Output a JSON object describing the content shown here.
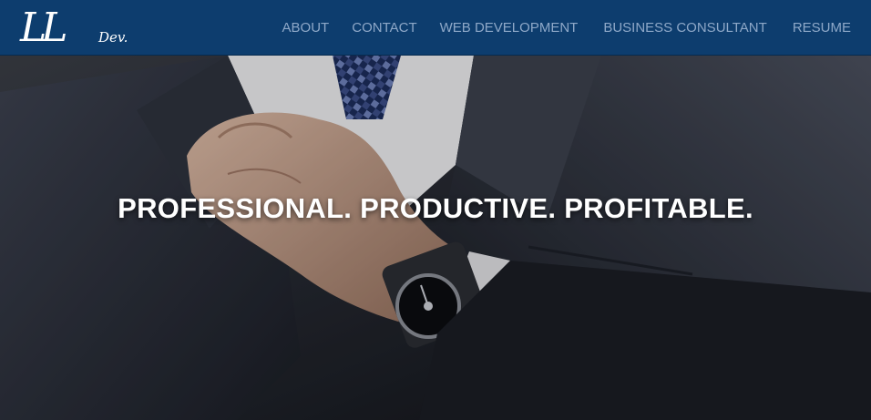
{
  "brand": {
    "initials": "LL",
    "suffix": "Dev."
  },
  "nav": {
    "items": [
      {
        "label": "ABOUT"
      },
      {
        "label": "CONTACT"
      },
      {
        "label": "WEB DEVELOPMENT"
      },
      {
        "label": "BUSINESS CONSULTANT"
      },
      {
        "label": "RESUME"
      }
    ]
  },
  "hero": {
    "headline": "PROFESSIONAL. PRODUCTIVE. PROFITABLE.",
    "image": "man-in-suit-adjusting-tie-photo"
  },
  "colors": {
    "navbar_bg": "#0d3d6e",
    "nav_link": "#8ea8c8",
    "headline": "#ffffff"
  }
}
